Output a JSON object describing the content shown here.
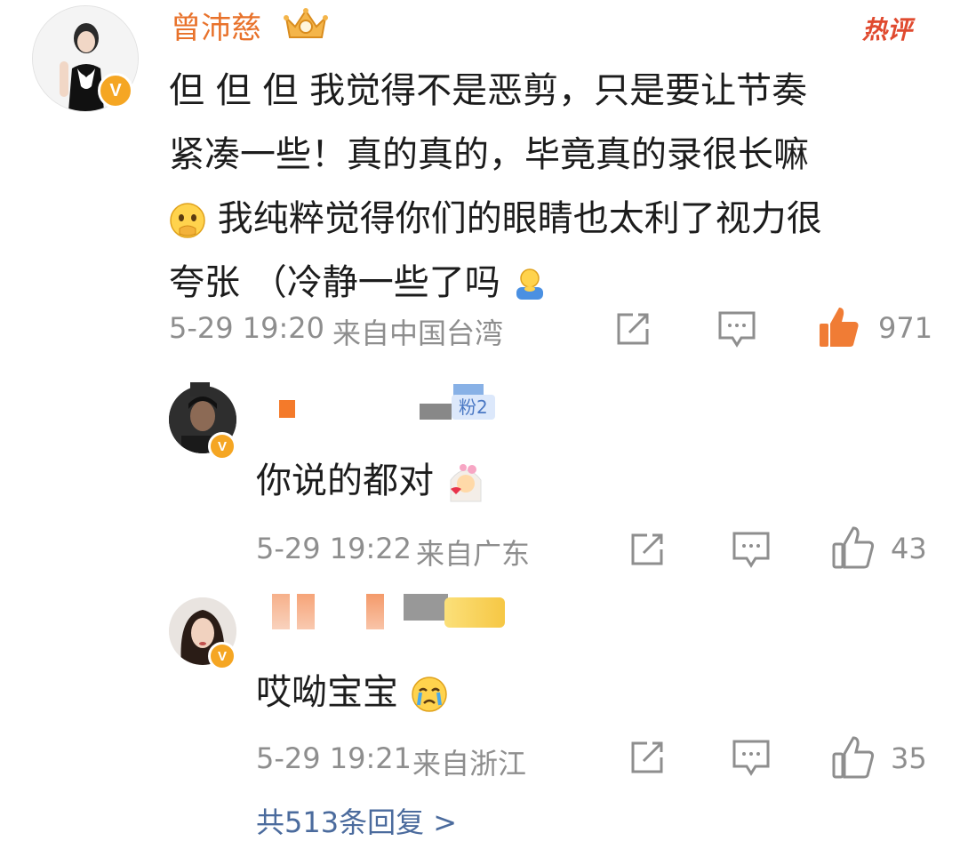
{
  "main_comment": {
    "author": "曾沛慈",
    "hot_tag": "热评",
    "text_line1": "但 但 但 我觉得不是恶剪，只是要让节奏",
    "text_line2": "紧凑一些！真的真的，毕竟真的录很长嘛",
    "text_line3": "我纯粹觉得你们的眼睛也太利了视力很",
    "text_line4": "夸张 （冷静一些了吗",
    "time": "5-29 19:20",
    "location": "来自中国台湾",
    "likes": "971",
    "liked": true
  },
  "replies": [
    {
      "author_badge": "粉2",
      "text": "你说的都对",
      "time": "5-29 19:22",
      "location": "来自广东",
      "likes": "43"
    },
    {
      "text": "哎呦宝宝",
      "time": "5-29 19:21",
      "location": "来自浙江",
      "likes": "35"
    }
  ],
  "more_replies": "共513条回复 >",
  "colors": {
    "author": "#e8722b",
    "liked": "#f07c35",
    "meta": "#8e8e8e",
    "link": "#4b6b9d",
    "verified": "#f5a623"
  }
}
